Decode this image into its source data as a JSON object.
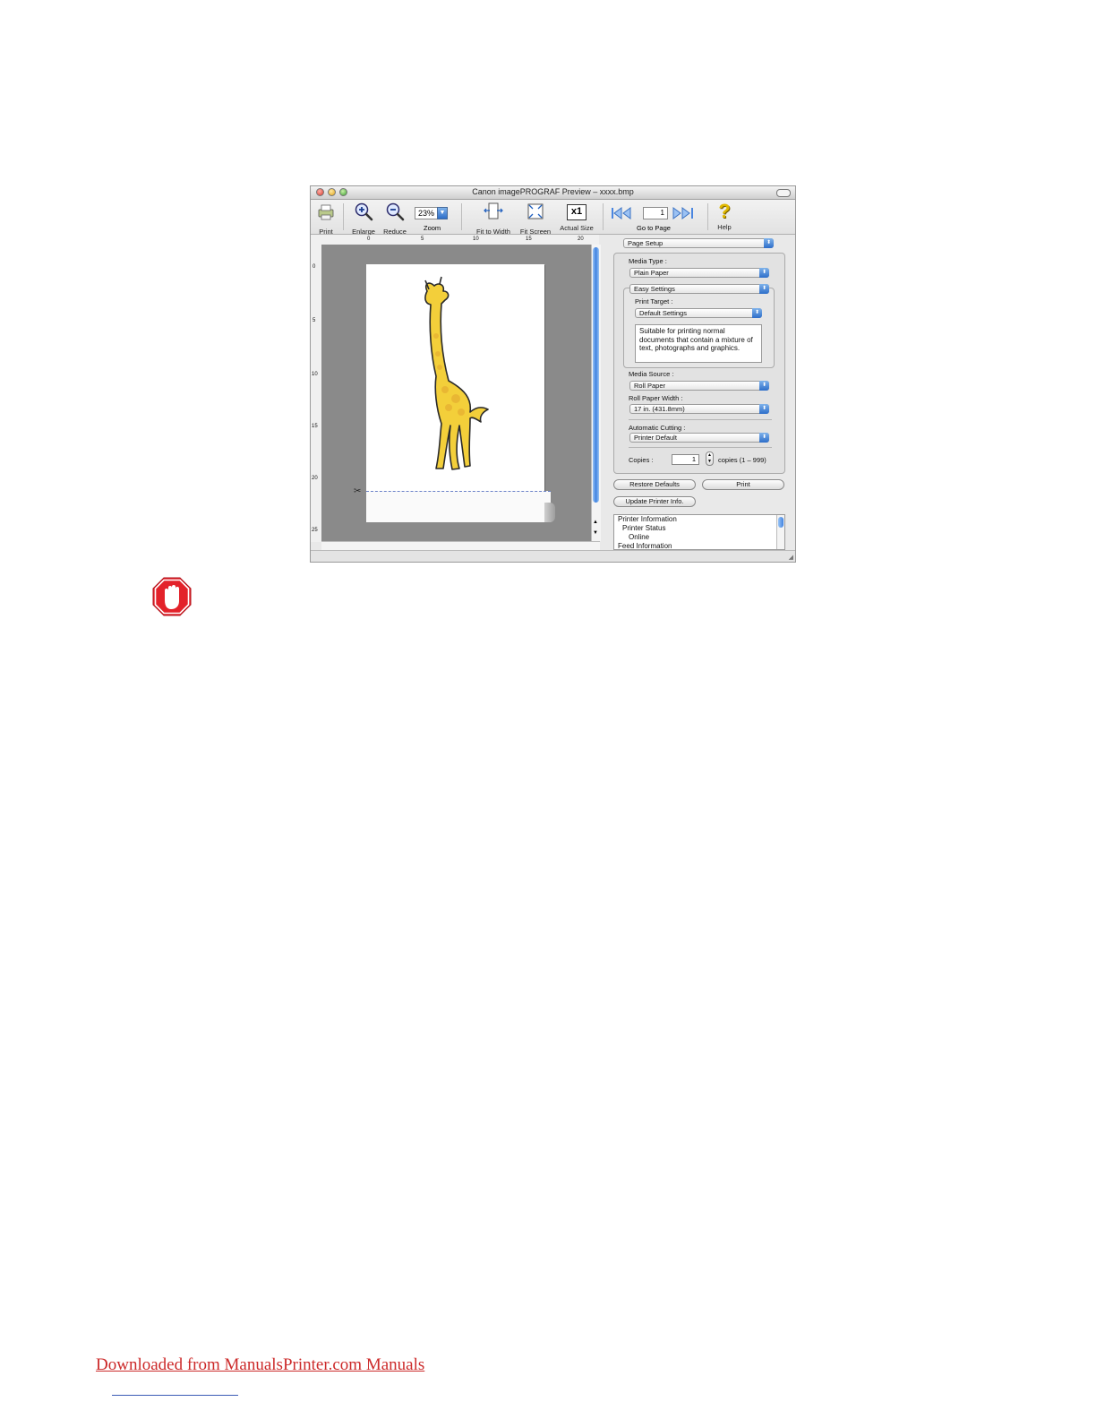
{
  "window": {
    "title": "Canon imagePROGRAF Preview – xxxx.bmp"
  },
  "toolbar": {
    "print": "Print",
    "enlarge": "Enlarge",
    "reduce": "Reduce",
    "zoom_value": "23%",
    "zoom": "Zoom",
    "fit_to_width": "Fit to Width",
    "fit_screen": "Fit Screen",
    "actual_size_icon_text": "x1",
    "actual_size": "Actual Size",
    "page_value": "1",
    "go_to_page": "Go to Page",
    "help": "Help"
  },
  "rulers": {
    "horizontal": [
      "0",
      "5",
      "10",
      "15",
      "20"
    ],
    "vertical": [
      "0",
      "5",
      "10",
      "15",
      "20",
      "25"
    ]
  },
  "panel": {
    "section": "Page Setup",
    "media_type_label": "Media Type :",
    "media_type": "Plain Paper",
    "easy_settings": "Easy Settings",
    "print_target_label": "Print Target :",
    "print_target": "Default Settings",
    "description": "Suitable for printing normal documents that contain a mixture of text, photographs and graphics.",
    "media_source_label": "Media Source :",
    "media_source": "Roll Paper",
    "roll_width_label": "Roll Paper Width :",
    "roll_width": "17 in. (431.8mm)",
    "auto_cut_label": "Automatic Cutting :",
    "auto_cut": "Printer Default",
    "copies_label": "Copies :",
    "copies_value": "1",
    "copies_range": "copies (1 – 999)",
    "restore_defaults": "Restore Defaults",
    "print_button": "Print",
    "update_printer_info": "Update Printer Info."
  },
  "printer_info": [
    "Printer Information",
    "Printer Status",
    "Online",
    "Feed Information"
  ],
  "footer_link": "Downloaded from ManualsPrinter.com Manuals"
}
